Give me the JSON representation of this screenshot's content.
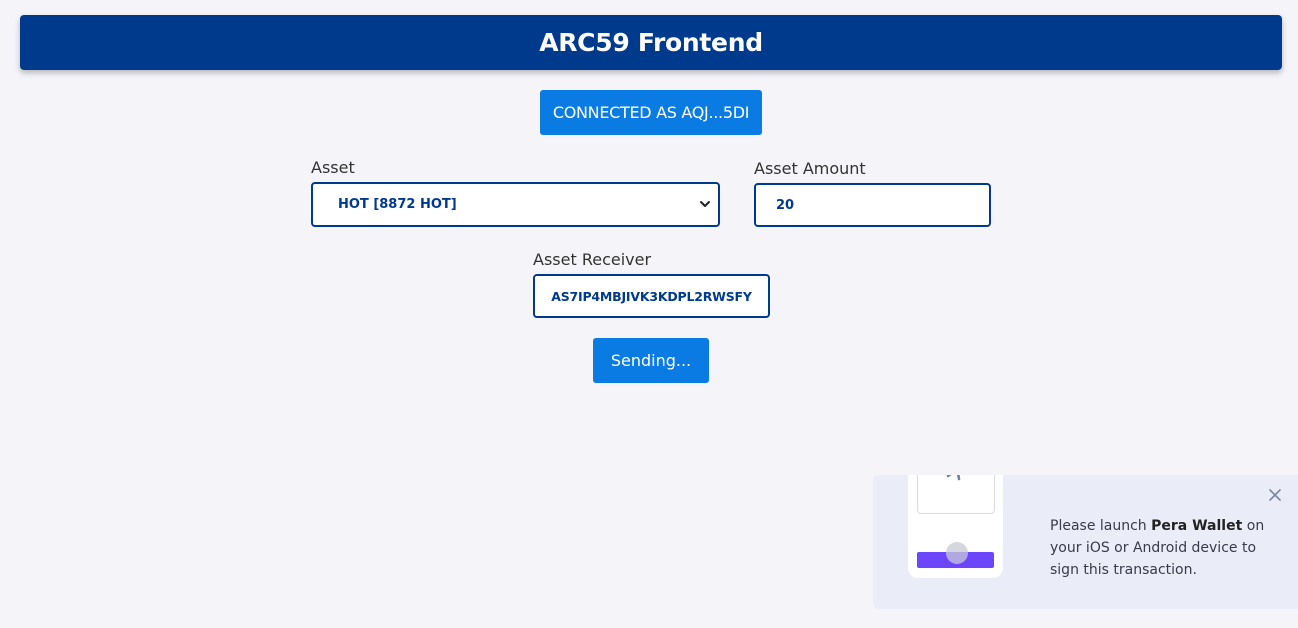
{
  "header": {
    "title": "ARC59 Frontend"
  },
  "connect_button": {
    "label": "CONNECTED AS AQJ...5DI"
  },
  "form": {
    "asset": {
      "label": "Asset",
      "selected": "HOT [8872 HOT]"
    },
    "amount": {
      "label": "Asset Amount",
      "value": "20"
    },
    "receiver": {
      "label": "Asset Receiver",
      "value": "AS7IP4MBJIVK3KDPL2RWSFY"
    },
    "send_button": {
      "label": "Sending..."
    }
  },
  "toast": {
    "prefix": "Please launch ",
    "app_name": "Pera Wallet",
    "suffix": " on your iOS or Android device to sign this transaction."
  },
  "colors": {
    "header_bg": "#003a8c",
    "button_bg": "#0a7be3",
    "page_bg": "#f4f4f9",
    "toast_bg": "#eaecf8",
    "pera_purple": "#6b46fe"
  },
  "icons": [
    "chevron-down-icon",
    "spinner-icon",
    "close-icon"
  ]
}
